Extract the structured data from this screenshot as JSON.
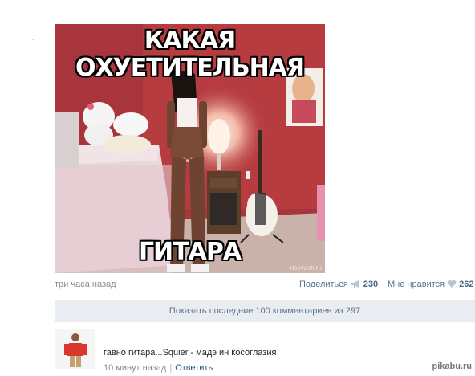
{
  "post": {
    "meme_top": "КАКАЯ\nОХУЕТИТЕЛЬНАЯ",
    "meme_bottom": "ГИТАРА",
    "image_watermark": "risovach.ru",
    "time": "три часа назад",
    "share_label": "Поделиться",
    "share_count": "230",
    "like_label": "Мне нравится",
    "like_count": "262"
  },
  "comments_bar": {
    "label": "Показать последние 100 комментариев из 297"
  },
  "comment": {
    "text": "гавно гитара...Squier - мадэ ин косоглазия",
    "time": "10 минут назад",
    "separator": "|",
    "reply_label": "Ответить"
  },
  "site": {
    "watermark": "pikabu.ru"
  },
  "colors": {
    "link": "#2b587a",
    "bar": "#e9edf1",
    "wall": "#9c3338"
  },
  "icons": {
    "share": "megaphone-icon",
    "like": "heart-icon"
  }
}
